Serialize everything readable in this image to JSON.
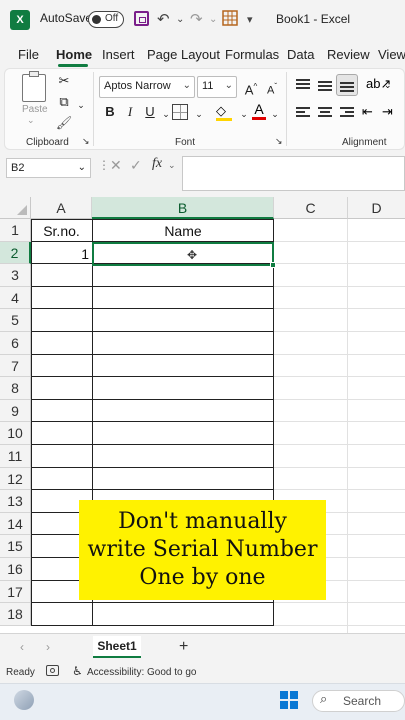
{
  "titlebar": {
    "app_icon": "X",
    "autosave_label": "AutoSave",
    "autosave_state": "Off",
    "title": "Book1 - Excel"
  },
  "tabs": [
    "File",
    "Home",
    "Insert",
    "Page Layout",
    "Formulas",
    "Data",
    "Review",
    "View"
  ],
  "ribbon": {
    "clipboard_label": "Clipboard",
    "paste_label": "Paste",
    "font_label": "Font",
    "alignment_label": "Alignment",
    "font_name": "Aptos Narrow",
    "font_size": "11",
    "bold": "B",
    "italic": "I",
    "underline": "U"
  },
  "formula_bar": {
    "name_box": "B2",
    "fx": "fx",
    "content": ""
  },
  "grid": {
    "columns": [
      "A",
      "B",
      "C",
      "D"
    ],
    "rows": [
      "1",
      "2",
      "3",
      "4",
      "5",
      "6",
      "7",
      "8",
      "9",
      "10",
      "11",
      "12",
      "13",
      "14",
      "15",
      "16",
      "17",
      "18"
    ],
    "header_a": "Sr.no.",
    "header_b": "Name",
    "a2": "1"
  },
  "overlay": {
    "line1": "Don't manually",
    "line2": "write Serial Number",
    "line3": "One by one"
  },
  "sheets": {
    "active": "Sheet1",
    "add": "+"
  },
  "status": {
    "ready": "Ready",
    "accessibility": "Accessibility: Good to go"
  },
  "taskbar": {
    "search": "Search"
  },
  "colors": {
    "accent": "#107c41",
    "banner": "#fff200"
  }
}
